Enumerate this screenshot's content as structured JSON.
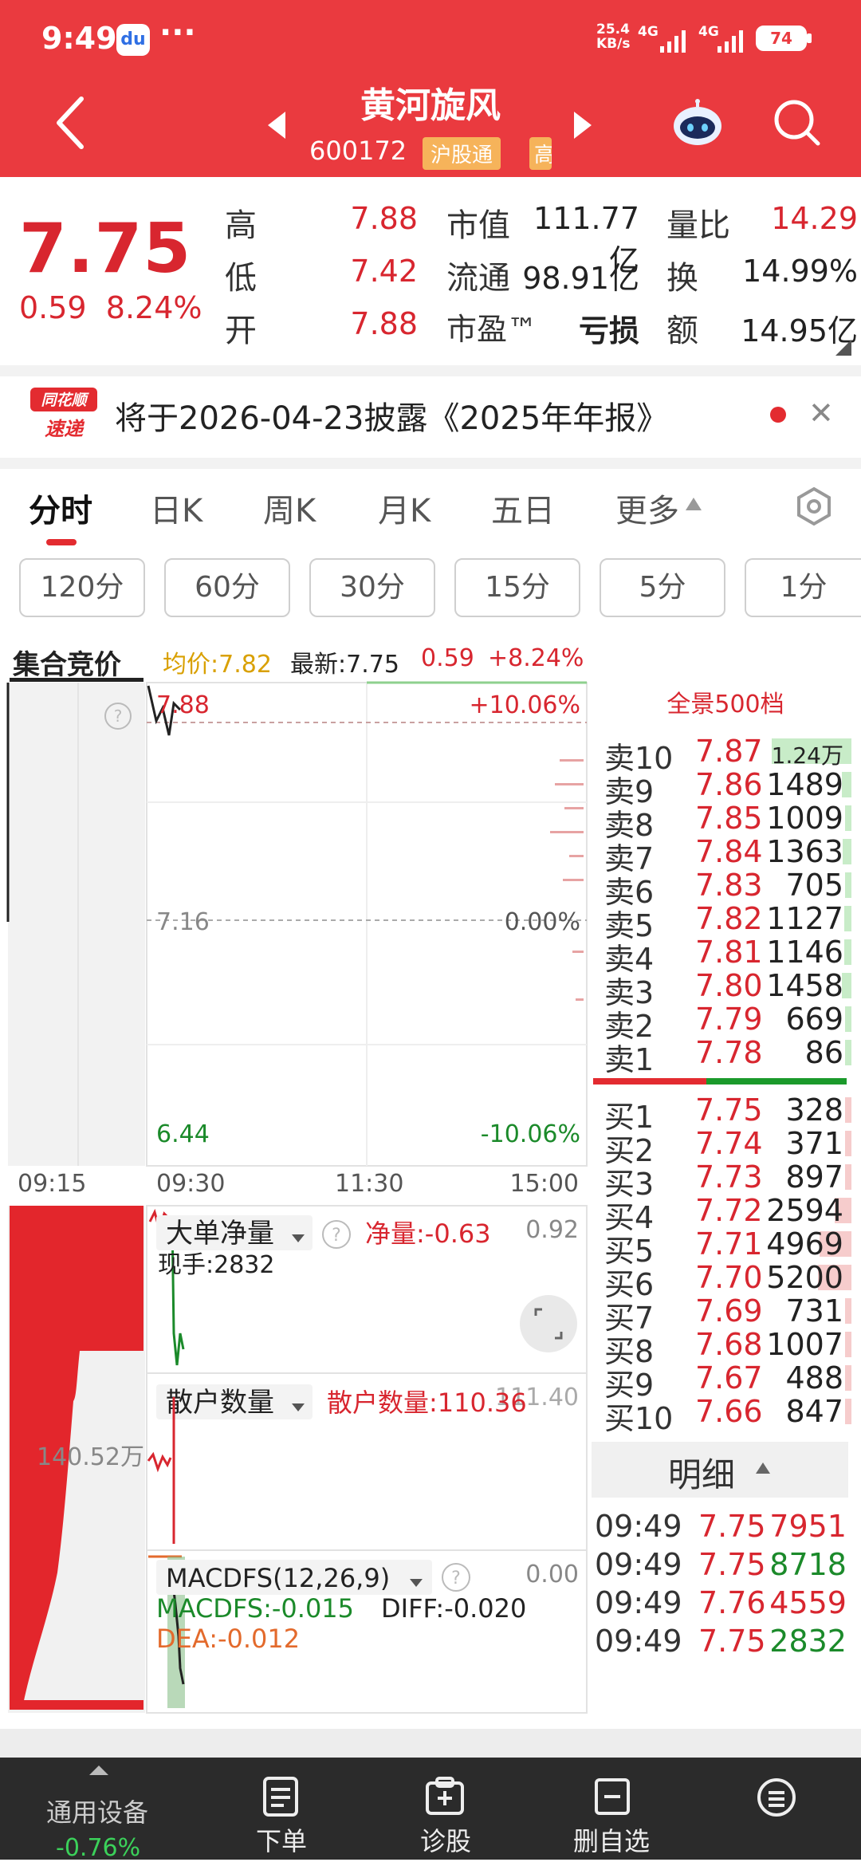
{
  "status": {
    "time": "9:49",
    "dots": "···",
    "net_speed": "25.4",
    "net_unit": "KB/s",
    "sig1": "4G",
    "sig2": "4G",
    "battery": "74"
  },
  "header": {
    "name": "黄河旋风",
    "code": "600172",
    "tag_connect": "沪股通",
    "tag_extra": "高"
  },
  "quote": {
    "price": "7.75",
    "change": "0.59",
    "change_pct": "8.24%",
    "cells": [
      {
        "label": "高",
        "value": "7.88"
      },
      {
        "label": "低",
        "value": "7.42"
      },
      {
        "label": "开",
        "value": "7.88"
      },
      {
        "label": "市值",
        "value": "111.77亿"
      },
      {
        "label": "流通",
        "value": "98.91亿"
      },
      {
        "label": "市盈™",
        "value": "亏损"
      },
      {
        "label": "量比",
        "value": "14.29"
      },
      {
        "label": "换",
        "value": "14.99%"
      },
      {
        "label": "额",
        "value": "14.95亿"
      }
    ]
  },
  "notice": {
    "logo_top": "同花顺",
    "logo_bottom": "速递",
    "text": "将于2026-04-23披露《2025年年报》"
  },
  "tabs": [
    "分时",
    "日K",
    "周K",
    "月K",
    "五日",
    "更多"
  ],
  "periods": [
    "120分",
    "60分",
    "30分",
    "15分",
    "5分",
    "1分"
  ],
  "chart_header": {
    "auction": "集合竞价",
    "avg": "均价:7.82",
    "latest": "最新:7.75",
    "chg": "0.59",
    "pct": "+8.24%"
  },
  "chart_data": {
    "type": "line",
    "price_axis": {
      "top": "7.88",
      "mid": "7.16",
      "bottom": "6.44",
      "top_pct": "+10.06%",
      "mid_pct": "0.00%",
      "bottom_pct": "-10.06%"
    },
    "time_axis": [
      "09:15",
      "09:30",
      "11:30",
      "15:00"
    ],
    "auction_volume": "140.52万",
    "indicators": {
      "big_order": {
        "name": "大单净量",
        "net": "净量:-0.63",
        "value": "0.92",
        "hand": "现手:2832"
      },
      "retail": {
        "name": "散户数量",
        "label": "散户数量:110.36",
        "value": "111.40"
      },
      "macd": {
        "name": "MACDFS(12,26,9)",
        "macdfs": "MACDFS:-0.015",
        "diff": "DIFF:-0.020",
        "dea": "DEA:-0.012",
        "value": "0.00"
      }
    }
  },
  "orderbook": {
    "title": "全景500档",
    "sell": [
      {
        "label": "卖10",
        "price": "7.87",
        "vol": "1.24万",
        "ratio": 1.0
      },
      {
        "label": "卖9",
        "price": "7.86",
        "vol": "1489",
        "ratio": 0.12
      },
      {
        "label": "卖8",
        "price": "7.85",
        "vol": "1009",
        "ratio": 0.08
      },
      {
        "label": "卖7",
        "price": "7.84",
        "vol": "1363",
        "ratio": 0.11
      },
      {
        "label": "卖6",
        "price": "7.83",
        "vol": "705",
        "ratio": 0.06
      },
      {
        "label": "卖5",
        "price": "7.82",
        "vol": "1127",
        "ratio": 0.09
      },
      {
        "label": "卖4",
        "price": "7.81",
        "vol": "1146",
        "ratio": 0.09
      },
      {
        "label": "卖3",
        "price": "7.80",
        "vol": "1458",
        "ratio": 0.12
      },
      {
        "label": "卖2",
        "price": "7.79",
        "vol": "669",
        "ratio": 0.05
      },
      {
        "label": "卖1",
        "price": "7.78",
        "vol": "86",
        "ratio": 0.01
      }
    ],
    "buy": [
      {
        "label": "买1",
        "price": "7.75",
        "vol": "328",
        "ratio": 0.03
      },
      {
        "label": "买2",
        "price": "7.74",
        "vol": "371",
        "ratio": 0.03
      },
      {
        "label": "买3",
        "price": "7.73",
        "vol": "897",
        "ratio": 0.07
      },
      {
        "label": "买4",
        "price": "7.72",
        "vol": "2594",
        "ratio": 0.21
      },
      {
        "label": "买5",
        "price": "7.71",
        "vol": "4969",
        "ratio": 0.4
      },
      {
        "label": "买6",
        "price": "7.70",
        "vol": "5200",
        "ratio": 0.42
      },
      {
        "label": "买7",
        "price": "7.69",
        "vol": "731",
        "ratio": 0.06
      },
      {
        "label": "买8",
        "price": "7.68",
        "vol": "1007",
        "ratio": 0.08
      },
      {
        "label": "买9",
        "price": "7.67",
        "vol": "488",
        "ratio": 0.04
      },
      {
        "label": "买10",
        "price": "7.66",
        "vol": "847",
        "ratio": 0.07
      }
    ]
  },
  "details": {
    "label": "明细",
    "rows": [
      {
        "time": "09:49",
        "price": "7.75",
        "vol": "7951",
        "dir": "red"
      },
      {
        "time": "09:49",
        "price": "7.75",
        "vol": "8718",
        "dir": "green"
      },
      {
        "time": "09:49",
        "price": "7.76",
        "vol": "4559",
        "dir": "red"
      },
      {
        "time": "09:49",
        "price": "7.75",
        "vol": "2832",
        "dir": "green"
      }
    ]
  },
  "nav": {
    "device": "通用设备",
    "device_pct": "-0.76%",
    "items": [
      "下单",
      "诊股",
      "删自选"
    ]
  },
  "colors": {
    "brand_red": "#ea3a3f",
    "up": "#d8262f",
    "down": "#1b8a2a"
  }
}
